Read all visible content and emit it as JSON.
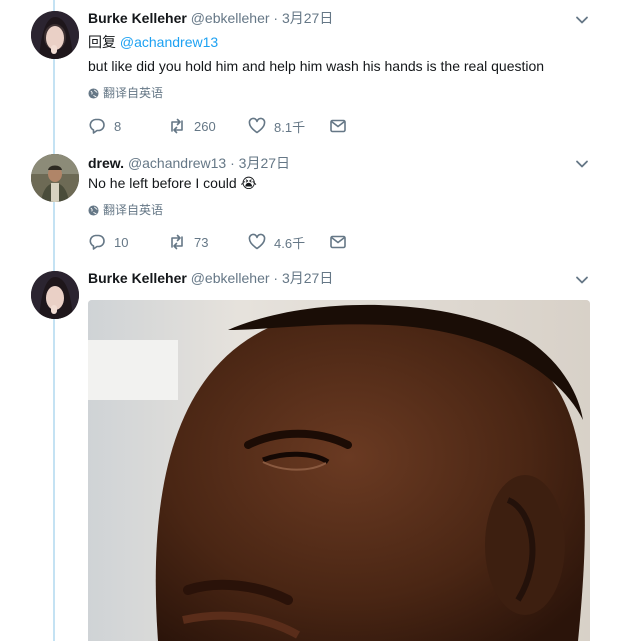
{
  "tweets": [
    {
      "author_name": "Burke Kelleher",
      "handle": "@ebkelleher",
      "separator": "·",
      "date": "3月27日",
      "reply_prefix": "回复",
      "reply_mention": "@achandrew13",
      "text": "but like did you hold him and help him wash his hands is the real question",
      "translate_label": "翻译自英语",
      "replies": "8",
      "retweets": "260",
      "likes": "8.1千"
    },
    {
      "author_name": "drew.",
      "handle": "@achandrew13",
      "separator": "·",
      "date": "3月27日",
      "text": "No he left before I could",
      "emoji": "😭",
      "translate_label": "翻译自英语",
      "replies": "10",
      "retweets": "73",
      "likes": "4.6千"
    },
    {
      "author_name": "Burke Kelleher",
      "handle": "@ebkelleher",
      "separator": "·",
      "date": "3月27日"
    }
  ],
  "colors": {
    "link": "#1da1f2",
    "secondary_text": "#657786",
    "thread_line": "#c4e2f3"
  },
  "icons": [
    "chevron-down-icon",
    "globe-icon",
    "reply-icon",
    "retweet-icon",
    "like-icon",
    "direct-message-icon"
  ]
}
